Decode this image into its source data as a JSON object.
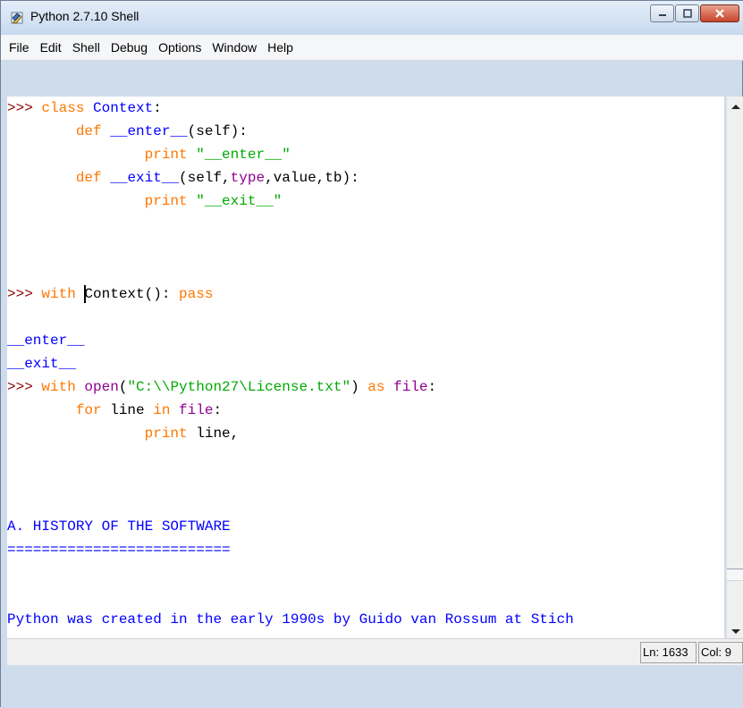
{
  "window": {
    "title": "Python 2.7.10 Shell",
    "icon": "python-shell-icon",
    "controls": [
      "minimize",
      "maximize",
      "close"
    ]
  },
  "menu": [
    "File",
    "Edit",
    "Shell",
    "Debug",
    "Options",
    "Window",
    "Help"
  ],
  "shell": {
    "lines": [
      [
        {
          "t": ">>> ",
          "c": "prompt"
        },
        {
          "t": "class",
          "c": "kw"
        },
        {
          "t": " ",
          "c": ""
        },
        {
          "t": "Context",
          "c": "def"
        },
        {
          "t": ":",
          "c": ""
        }
      ],
      [
        {
          "t": "        ",
          "c": ""
        },
        {
          "t": "def",
          "c": "kw"
        },
        {
          "t": " ",
          "c": ""
        },
        {
          "t": "__enter__",
          "c": "def"
        },
        {
          "t": "(self):",
          "c": ""
        }
      ],
      [
        {
          "t": "                ",
          "c": ""
        },
        {
          "t": "print",
          "c": "kw"
        },
        {
          "t": " ",
          "c": ""
        },
        {
          "t": "\"__enter__\"",
          "c": "str"
        }
      ],
      [
        {
          "t": "        ",
          "c": ""
        },
        {
          "t": "def",
          "c": "kw"
        },
        {
          "t": " ",
          "c": ""
        },
        {
          "t": "__exit__",
          "c": "def"
        },
        {
          "t": "(self,",
          "c": ""
        },
        {
          "t": "type",
          "c": "bi"
        },
        {
          "t": ",value,tb):",
          "c": ""
        }
      ],
      [
        {
          "t": "                ",
          "c": ""
        },
        {
          "t": "print",
          "c": "kw"
        },
        {
          "t": " ",
          "c": ""
        },
        {
          "t": "\"__exit__\"",
          "c": "str"
        }
      ],
      [],
      [],
      [],
      [
        {
          "t": ">>> ",
          "c": "prompt"
        },
        {
          "t": "with",
          "c": "kw"
        },
        {
          "t": " ",
          "c": ""
        },
        {
          "t": "",
          "c": "cursor"
        },
        {
          "t": "Context(): ",
          "c": ""
        },
        {
          "t": "pass",
          "c": "kw"
        }
      ],
      [],
      [
        {
          "t": "__enter__",
          "c": "out"
        }
      ],
      [
        {
          "t": "__exit__",
          "c": "out"
        }
      ],
      [
        {
          "t": ">>> ",
          "c": "prompt"
        },
        {
          "t": "with",
          "c": "kw"
        },
        {
          "t": " ",
          "c": ""
        },
        {
          "t": "open",
          "c": "bi"
        },
        {
          "t": "(",
          "c": ""
        },
        {
          "t": "\"C:\\\\Python27\\License.txt\"",
          "c": "str"
        },
        {
          "t": ") ",
          "c": ""
        },
        {
          "t": "as",
          "c": "kw"
        },
        {
          "t": " ",
          "c": ""
        },
        {
          "t": "file",
          "c": "bi"
        },
        {
          "t": ":",
          "c": ""
        }
      ],
      [
        {
          "t": "        ",
          "c": ""
        },
        {
          "t": "for",
          "c": "kw"
        },
        {
          "t": " line ",
          "c": ""
        },
        {
          "t": "in",
          "c": "kw"
        },
        {
          "t": " ",
          "c": ""
        },
        {
          "t": "file",
          "c": "bi"
        },
        {
          "t": ":",
          "c": ""
        }
      ],
      [
        {
          "t": "                ",
          "c": ""
        },
        {
          "t": "print",
          "c": "kw"
        },
        {
          "t": " line,",
          "c": ""
        }
      ],
      [],
      [],
      [],
      [
        {
          "t": "A. HISTORY OF THE SOFTWARE",
          "c": "out"
        }
      ],
      [
        {
          "t": "==========================",
          "c": "out"
        }
      ],
      [],
      [],
      [
        {
          "t": "Python was created in the early 1990s by Guido van Rossum at Stich",
          "c": "out"
        }
      ]
    ]
  },
  "status": {
    "line": "Ln: 1633",
    "col": "Col: 9"
  },
  "colors": {
    "prompt": "#8a0606",
    "keyword": "#ff7700",
    "definition": "#0000ff",
    "string": "#00aa00",
    "builtin": "#900090",
    "output": "#0000ff"
  }
}
